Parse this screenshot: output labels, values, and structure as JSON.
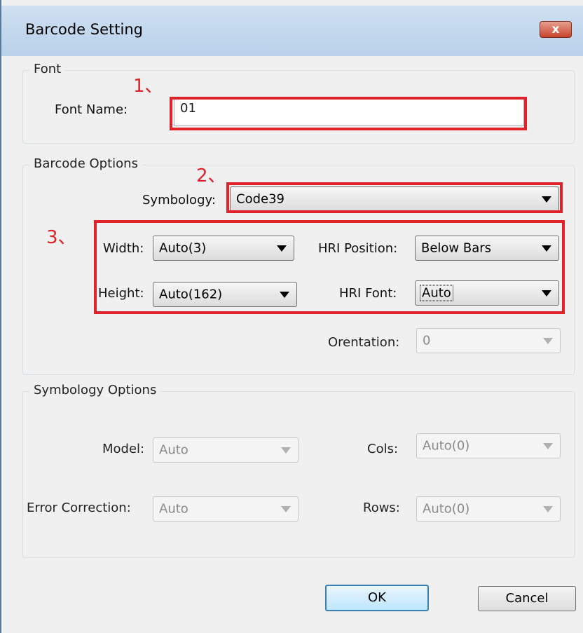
{
  "window": {
    "title": "Barcode Setting",
    "close_glyph": "x"
  },
  "font_group": {
    "legend": "Font",
    "font_name_label": "Font Name:",
    "font_name_value": "01"
  },
  "barcode_group": {
    "legend": "Barcode Options",
    "symbology_label": "Symbology:",
    "symbology_value": "Code39",
    "width_label": "Width:",
    "width_value": "Auto(3)",
    "height_label": "Height:",
    "height_value": "Auto(162)",
    "hri_position_label": "HRI Position:",
    "hri_position_value": "Below Bars",
    "hri_font_label": "HRI Font:",
    "hri_font_value": "Auto",
    "orientation_label": "Orentation:",
    "orientation_value": "0"
  },
  "symbology_group": {
    "legend": "Symbology Options",
    "model_label": "Model:",
    "model_value": "Auto",
    "error_correction_label": "Error Correction:",
    "error_correction_value": "Auto",
    "cols_label": "Cols:",
    "cols_value": "Auto(0)",
    "rows_label": "Rows:",
    "rows_value": "Auto(0)"
  },
  "annotations": {
    "n1": "1、",
    "n2": "2、",
    "n3": "3、",
    "color": "#e0222a"
  },
  "buttons": {
    "ok": "OK",
    "cancel": "Cancel"
  }
}
